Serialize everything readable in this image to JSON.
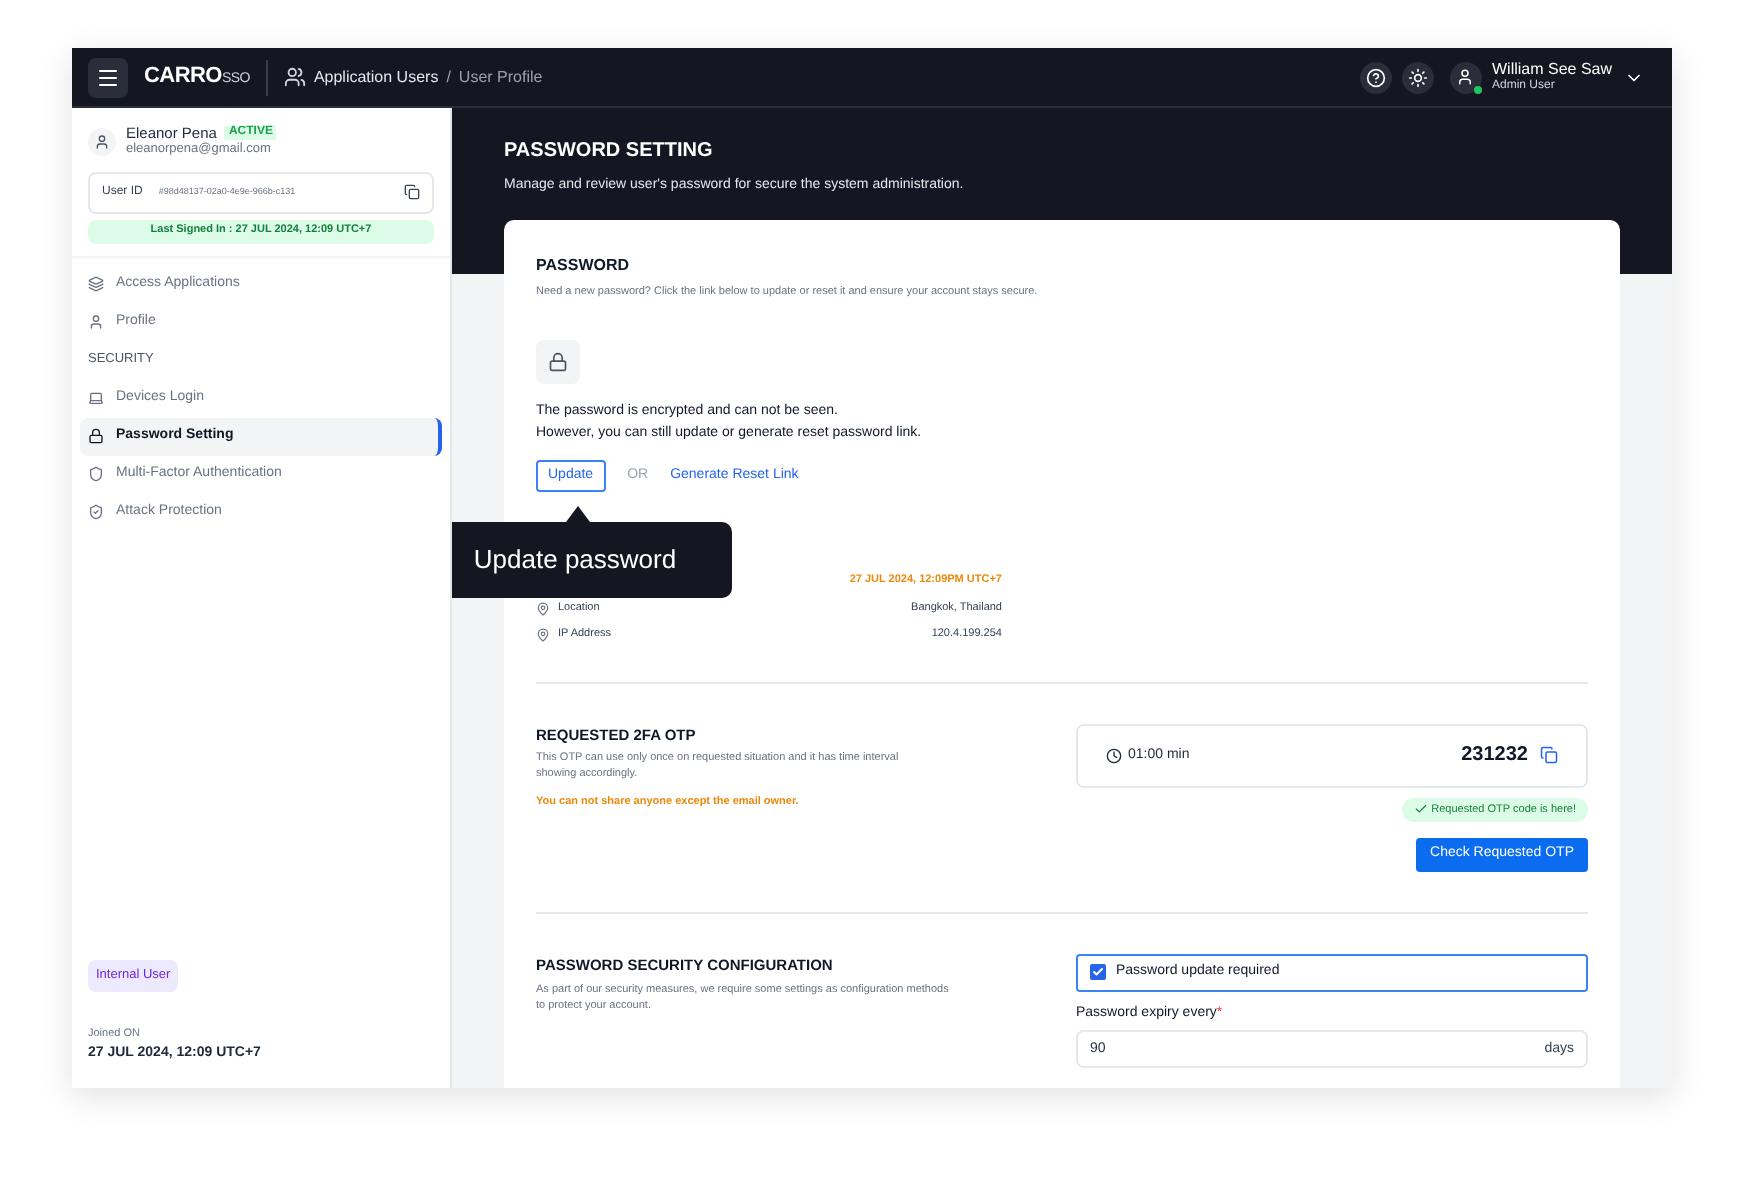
{
  "topbar": {
    "logo": "CARRO",
    "logo_suffix": "SSO",
    "breadcrumb": [
      "Application Users",
      "User Profile"
    ],
    "breadcrumb_separator": "/",
    "user": {
      "name": "William See Saw",
      "role": "Admin User",
      "online": true
    }
  },
  "sidebar": {
    "profile": {
      "name": "Eleanor Pena",
      "status": "ACTIVE",
      "email": "eleanorpena@gmail.com"
    },
    "user_id": {
      "label": "User ID",
      "value": "#98d48137-02a0-4e9e-966b-c131"
    },
    "last_signed": "Last Signed In : 27 JUL 2024, 12:09 UTC+7",
    "items": [
      {
        "kind": "item",
        "label": "Access Applications",
        "selected": false
      },
      {
        "kind": "item",
        "label": "Profile",
        "selected": false
      },
      {
        "kind": "section",
        "label": "SECURITY"
      },
      {
        "kind": "item",
        "label": "Devices Login",
        "selected": false
      },
      {
        "kind": "item",
        "label": "Password Setting",
        "selected": true
      },
      {
        "kind": "item",
        "label": "Multi-Factor Authentication",
        "selected": false
      },
      {
        "kind": "item",
        "label": "Attack Protection",
        "selected": false
      }
    ],
    "tag": "Internal User",
    "joined_label": "Joined ON",
    "joined_value": "27 JUL 2024, 12:09 UTC+7"
  },
  "page": {
    "title": "PASSWORD SETTING",
    "subtitle": "Manage and review user's password for secure the system administration."
  },
  "password": {
    "title": "PASSWORD",
    "description": "Need a new password? Click the link below to update or reset it and ensure your account stays secure.",
    "info": [
      "The password is encrypted and can not be seen.",
      "However, you can still update or generate reset password link."
    ],
    "update_button": "Update",
    "or": "OR",
    "reset_link": "Generate Reset Link",
    "tooltip": "Update password",
    "last_update": "27 JUL 2024, 12:09PM UTC+7",
    "details": [
      {
        "label": "Location",
        "value": "Bangkok, Thailand"
      },
      {
        "label": "IP Address",
        "value": "120.4.199.254"
      }
    ]
  },
  "otp": {
    "title": "REQUESTED 2FA OTP",
    "description": "This OTP can use only once on requested situation and it has time interval showing accordingly.",
    "warning": "You can not share anyone except the email owner.",
    "timer": "01:00 min",
    "code": "231232",
    "status": "Requested OTP code is here!",
    "button": "Check Requested OTP"
  },
  "config": {
    "title": "PASSWORD SECURITY CONFIGURATION",
    "description": "As part of our security measures, we require some settings as configuration methods to protect your account.",
    "checkbox": {
      "label": "Password update required",
      "checked": true
    },
    "expiry": {
      "label": "Password expiry every",
      "required": true,
      "required_mark": "*",
      "value": "90",
      "unit": "days"
    }
  }
}
